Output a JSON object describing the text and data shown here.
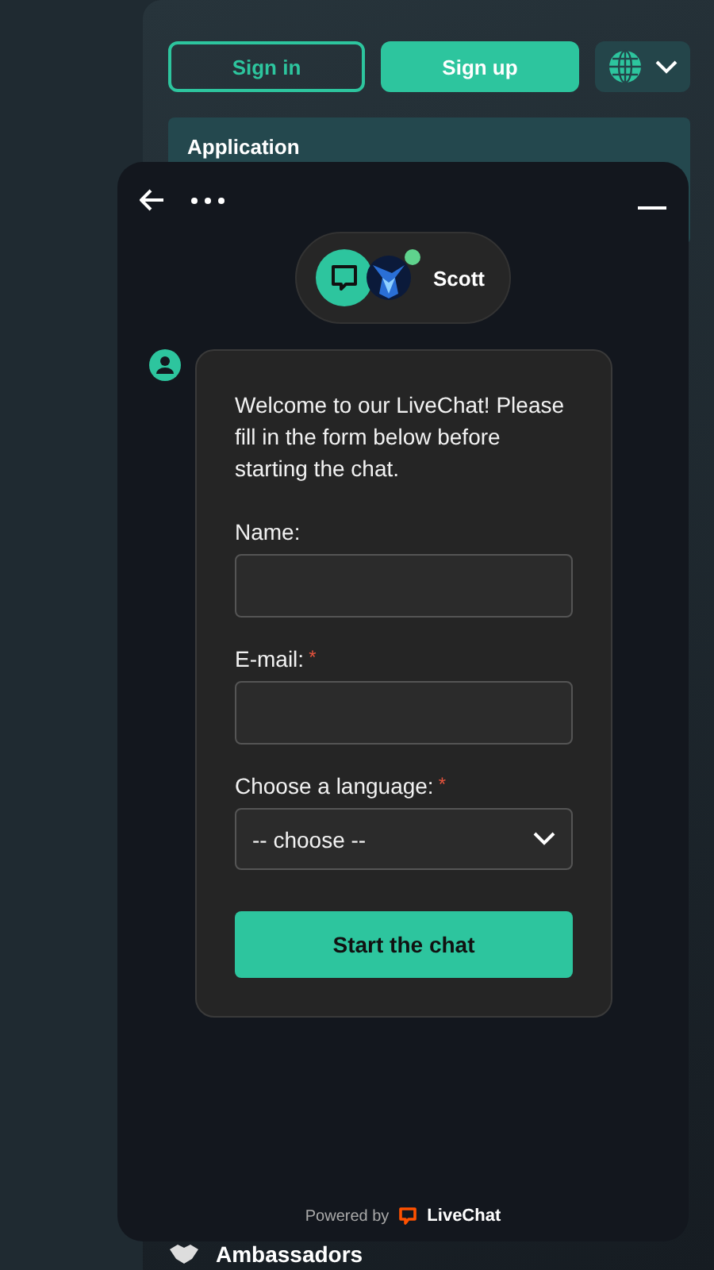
{
  "site": {
    "sign_in": "Sign in",
    "sign_up": "Sign up",
    "promo_title": "Application",
    "nav_item": "Ambassadors"
  },
  "chat": {
    "agent": {
      "name": "Scott",
      "online": true
    },
    "intro": "Welcome to our LiveChat! Please fill in the form below before starting the chat.",
    "fields": [
      {
        "kind": "text",
        "label": "Name:"
      },
      {
        "kind": "text",
        "label": "E-mail:",
        "required_mark": "*"
      },
      {
        "kind": "select",
        "label": "Choose a language:",
        "required_mark": "*",
        "value": "-- choose --"
      }
    ],
    "submit": "Start the chat",
    "footer": {
      "prefix": "Powered by",
      "brand": "LiveChat"
    }
  }
}
